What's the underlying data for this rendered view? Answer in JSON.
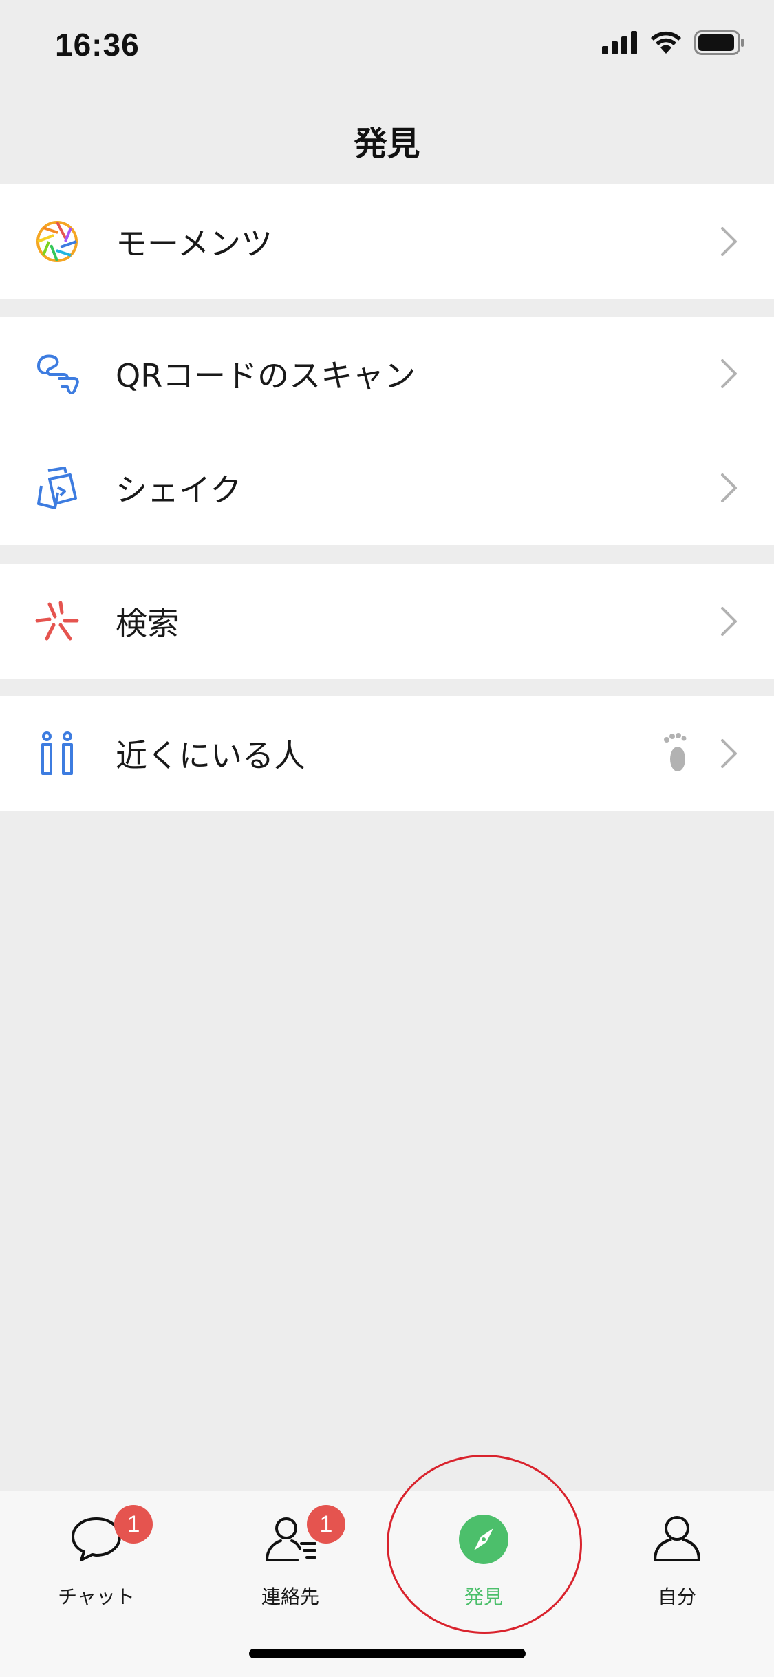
{
  "status_bar": {
    "time": "16:36",
    "icons": [
      "signal-icon",
      "wifi-icon",
      "battery-icon"
    ]
  },
  "nav": {
    "title": "発見"
  },
  "groups": [
    {
      "items": [
        {
          "label": "モーメンツ",
          "icon": "moments-aperture-icon"
        }
      ]
    },
    {
      "items": [
        {
          "label": "QRコードのスキャン",
          "icon": "scan-icon"
        },
        {
          "label": "シェイク",
          "icon": "shake-icon"
        }
      ]
    },
    {
      "items": [
        {
          "label": "検索",
          "icon": "search-sparkle-icon"
        }
      ]
    },
    {
      "items": [
        {
          "label": "近くにいる人",
          "icon": "people-nearby-icon",
          "extra_icon": "footprint-icon"
        }
      ]
    }
  ],
  "tabs": [
    {
      "label": "チャット",
      "icon": "chat-bubble-icon",
      "badge": "1",
      "active": false
    },
    {
      "label": "連絡先",
      "icon": "contacts-icon",
      "badge": "1",
      "active": false
    },
    {
      "label": "発見",
      "icon": "compass-icon",
      "active": true
    },
    {
      "label": "自分",
      "icon": "me-person-icon",
      "active": false
    }
  ],
  "colors": {
    "background": "#EDEDED",
    "active_tab": "#4CBF6B",
    "badge": "#E5544F",
    "annotation_circle": "#D9232D",
    "icon_blue": "#3D7CE0",
    "icon_red": "#E5544F"
  }
}
